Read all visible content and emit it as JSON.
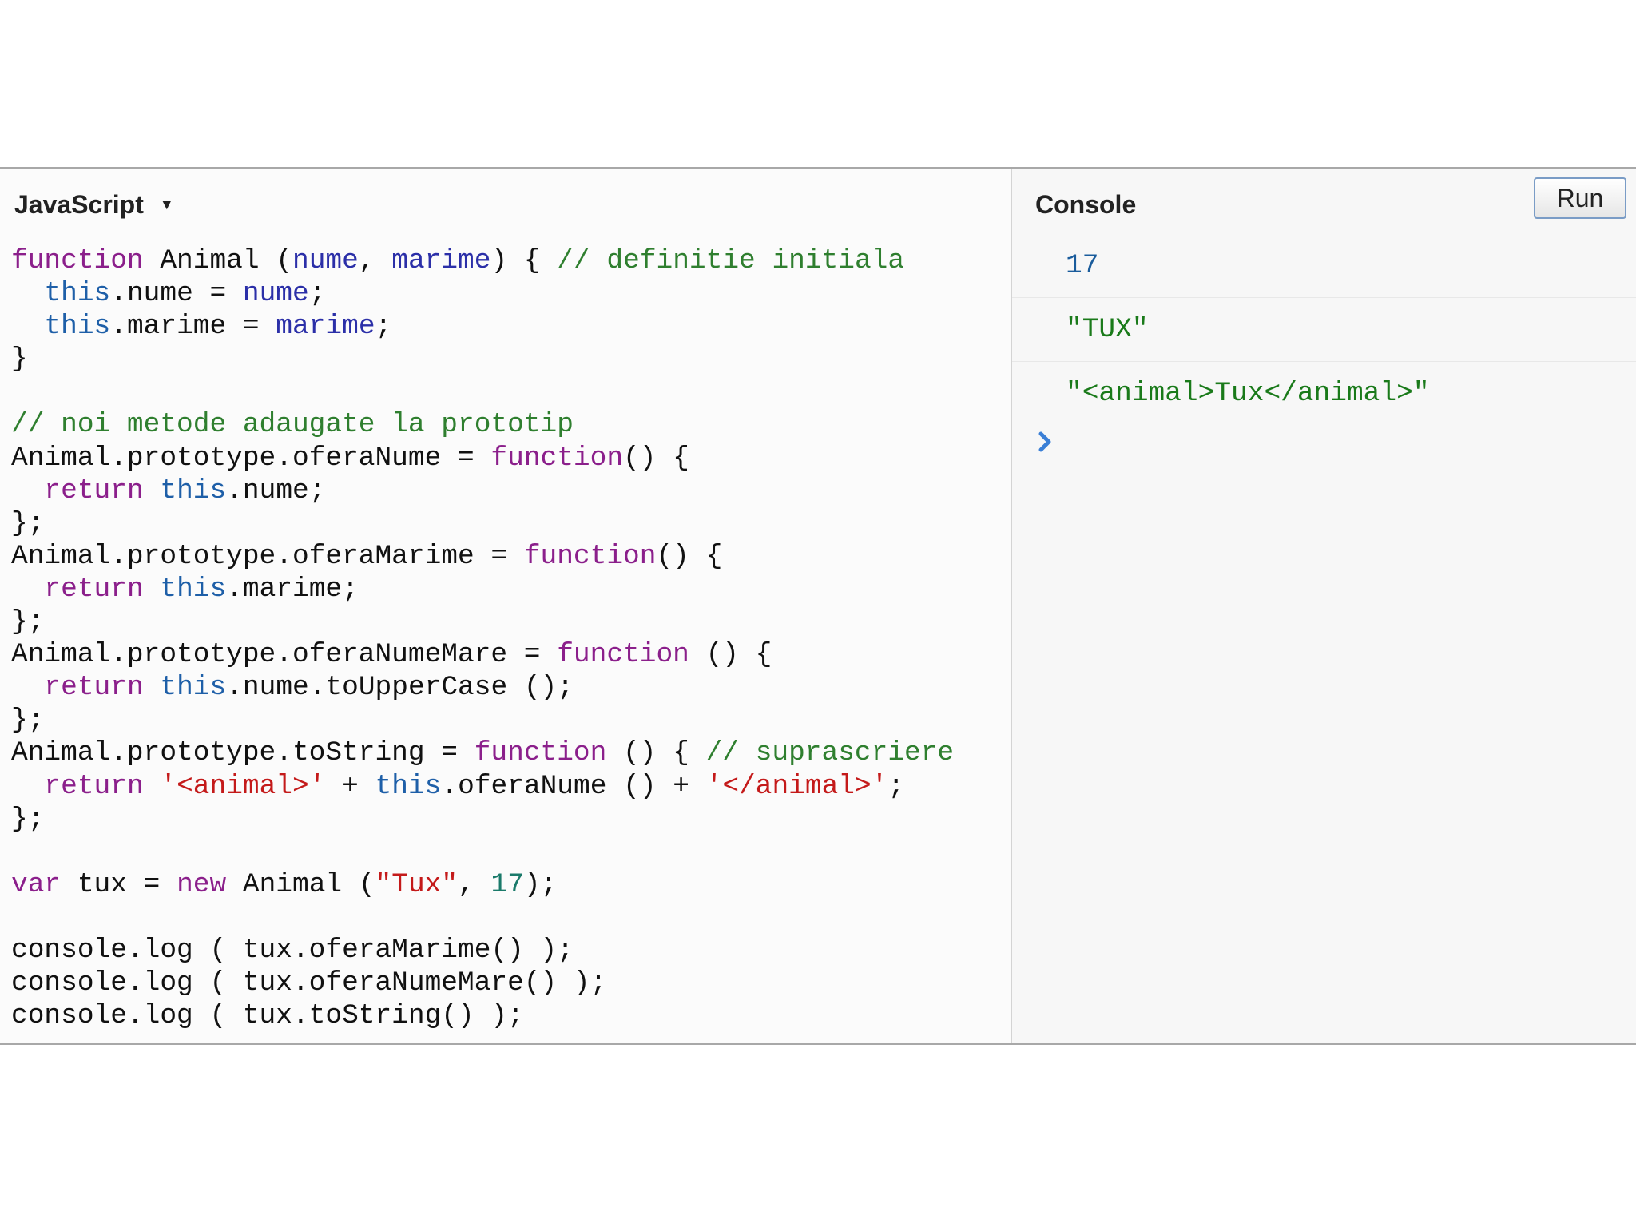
{
  "editor": {
    "language_label": "JavaScript",
    "code_lines": [
      [
        {
          "t": "function",
          "c": "k"
        },
        {
          "t": " Animal (",
          "c": ""
        },
        {
          "t": "nume",
          "c": "p"
        },
        {
          "t": ", ",
          "c": ""
        },
        {
          "t": "marime",
          "c": "p"
        },
        {
          "t": ") { ",
          "c": ""
        },
        {
          "t": "// definitie initiala",
          "c": "c"
        }
      ],
      [
        {
          "t": "  ",
          "c": ""
        },
        {
          "t": "this",
          "c": "th"
        },
        {
          "t": ".nume = ",
          "c": ""
        },
        {
          "t": "nume",
          "c": "p"
        },
        {
          "t": ";",
          "c": ""
        }
      ],
      [
        {
          "t": "  ",
          "c": ""
        },
        {
          "t": "this",
          "c": "th"
        },
        {
          "t": ".marime = ",
          "c": ""
        },
        {
          "t": "marime",
          "c": "p"
        },
        {
          "t": ";",
          "c": ""
        }
      ],
      [
        {
          "t": "}",
          "c": ""
        }
      ],
      [
        {
          "t": "",
          "c": ""
        }
      ],
      [
        {
          "t": "// noi metode adaugate la prototip",
          "c": "c"
        }
      ],
      [
        {
          "t": "Animal.prototype.oferaNume = ",
          "c": ""
        },
        {
          "t": "function",
          "c": "k"
        },
        {
          "t": "() {",
          "c": ""
        }
      ],
      [
        {
          "t": "  ",
          "c": ""
        },
        {
          "t": "return",
          "c": "k"
        },
        {
          "t": " ",
          "c": ""
        },
        {
          "t": "this",
          "c": "th"
        },
        {
          "t": ".nume;",
          "c": ""
        }
      ],
      [
        {
          "t": "};",
          "c": ""
        }
      ],
      [
        {
          "t": "Animal.prototype.oferaMarime = ",
          "c": ""
        },
        {
          "t": "function",
          "c": "k"
        },
        {
          "t": "() {",
          "c": ""
        }
      ],
      [
        {
          "t": "  ",
          "c": ""
        },
        {
          "t": "return",
          "c": "k"
        },
        {
          "t": " ",
          "c": ""
        },
        {
          "t": "this",
          "c": "th"
        },
        {
          "t": ".marime;",
          "c": ""
        }
      ],
      [
        {
          "t": "};",
          "c": ""
        }
      ],
      [
        {
          "t": "Animal.prototype.oferaNumeMare = ",
          "c": ""
        },
        {
          "t": "function",
          "c": "k"
        },
        {
          "t": " () {",
          "c": ""
        }
      ],
      [
        {
          "t": "  ",
          "c": ""
        },
        {
          "t": "return",
          "c": "k"
        },
        {
          "t": " ",
          "c": ""
        },
        {
          "t": "this",
          "c": "th"
        },
        {
          "t": ".nume.toUpperCase ();",
          "c": ""
        }
      ],
      [
        {
          "t": "};",
          "c": ""
        }
      ],
      [
        {
          "t": "Animal.prototype.toString = ",
          "c": ""
        },
        {
          "t": "function",
          "c": "k"
        },
        {
          "t": " () { ",
          "c": ""
        },
        {
          "t": "// suprascriere",
          "c": "c"
        }
      ],
      [
        {
          "t": "  ",
          "c": ""
        },
        {
          "t": "return",
          "c": "k"
        },
        {
          "t": " ",
          "c": ""
        },
        {
          "t": "'<animal>'",
          "c": "s"
        },
        {
          "t": " + ",
          "c": ""
        },
        {
          "t": "this",
          "c": "th"
        },
        {
          "t": ".oferaNume () + ",
          "c": ""
        },
        {
          "t": "'</animal>'",
          "c": "s"
        },
        {
          "t": ";",
          "c": ""
        }
      ],
      [
        {
          "t": "};",
          "c": ""
        }
      ],
      [
        {
          "t": "",
          "c": ""
        }
      ],
      [
        {
          "t": "var",
          "c": "k"
        },
        {
          "t": " tux = ",
          "c": ""
        },
        {
          "t": "new",
          "c": "k"
        },
        {
          "t": " Animal (",
          "c": ""
        },
        {
          "t": "\"Tux\"",
          "c": "s"
        },
        {
          "t": ", ",
          "c": ""
        },
        {
          "t": "17",
          "c": "n"
        },
        {
          "t": ");",
          "c": ""
        }
      ],
      [
        {
          "t": "",
          "c": ""
        }
      ],
      [
        {
          "t": "console.log ( tux.oferaMarime() );",
          "c": ""
        }
      ],
      [
        {
          "t": "console.log ( tux.oferaNumeMare() );",
          "c": ""
        }
      ],
      [
        {
          "t": "console.log ( tux.toString() );",
          "c": ""
        }
      ]
    ]
  },
  "console": {
    "title": "Console",
    "run_label": "Run",
    "outputs": [
      {
        "text": "17",
        "kind": "number"
      },
      {
        "text": "\"TUX\"",
        "kind": "string"
      },
      {
        "text": "\"<animal>Tux</animal>\"",
        "kind": "string"
      }
    ],
    "prompt_icon": "chevron-right-icon"
  },
  "colors": {
    "keyword": "#8b1f8b",
    "this": "#1e5fa8",
    "comment": "#2f7f2f",
    "string": "#c41a1a",
    "number_output": "#1a5c9c",
    "string_output": "#1a7a1a",
    "prompt": "#3a7fd6"
  }
}
